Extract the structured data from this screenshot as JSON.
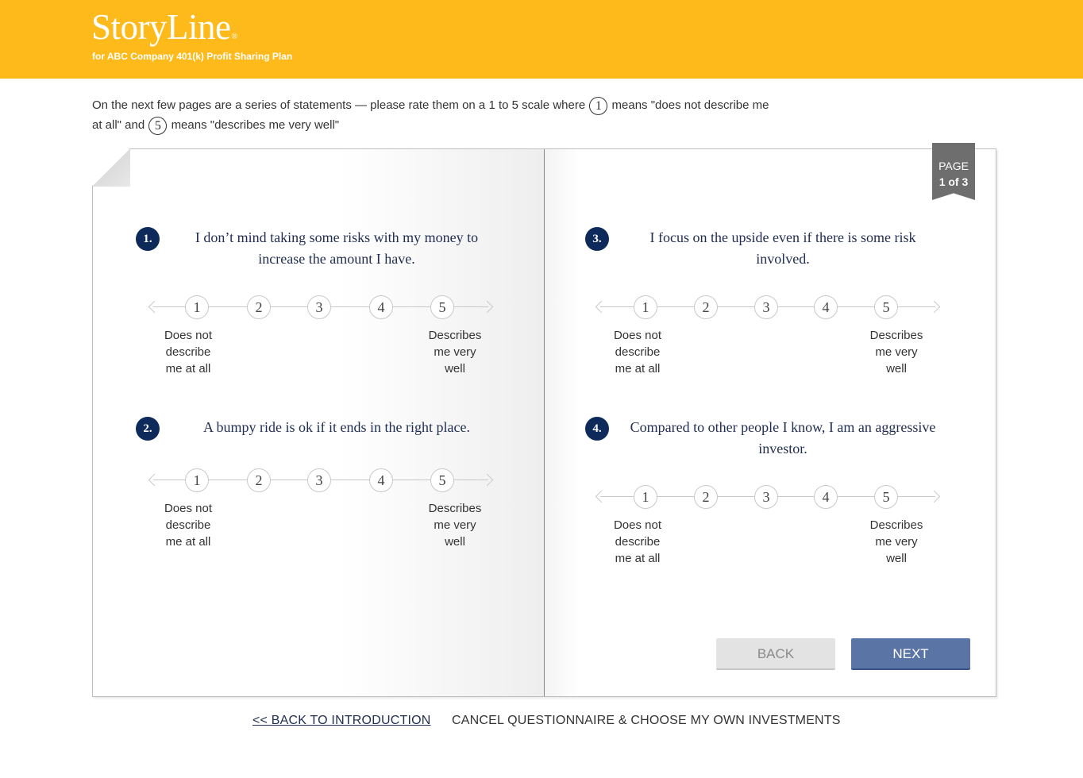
{
  "header": {
    "logo": "StoryLine",
    "logo_mark": "®",
    "subtitle": "for ABC Company 401(k) Profit Sharing Plan",
    "background_color": "#fdba1a"
  },
  "intro": {
    "part1": "On the next few pages are a series of statements — please rate them on a 1 to 5 scale where",
    "low_value": "1",
    "part2": "means \"does not describe me at all\" and",
    "high_value": "5",
    "part3": "means \"describes me very well\""
  },
  "page_indicator": {
    "label": "PAGE",
    "value": "1 of 3"
  },
  "questions": [
    {
      "number": "1.",
      "text_line1": "I don’t mind taking some risks with my money to",
      "text_line2": "increase the amount I have.",
      "options": [
        "1",
        "2",
        "3",
        "4",
        "5"
      ],
      "low_label": [
        "Does not",
        "describe",
        "me at all"
      ],
      "high_label": [
        "Describes",
        "me very",
        "well"
      ]
    },
    {
      "number": "2.",
      "text_line1": "A bumpy ride is ok if it ends in the right place.",
      "text_line2": "",
      "options": [
        "1",
        "2",
        "3",
        "4",
        "5"
      ],
      "low_label": [
        "Does not",
        "describe",
        "me at all"
      ],
      "high_label": [
        "Describes",
        "me very",
        "well"
      ]
    },
    {
      "number": "3.",
      "text_line1": "I focus on the upside even if there is some risk",
      "text_line2": "involved.",
      "options": [
        "1",
        "2",
        "3",
        "4",
        "5"
      ],
      "low_label": [
        "Does not",
        "describe",
        "me at all"
      ],
      "high_label": [
        "Describes",
        "me very",
        "well"
      ]
    },
    {
      "number": "4.",
      "text_line1": "Compared to other people I know, I am an aggressive",
      "text_line2": "investor.",
      "options": [
        "1",
        "2",
        "3",
        "4",
        "5"
      ],
      "low_label": [
        "Does not",
        "describe",
        "me at all"
      ],
      "high_label": [
        "Describes",
        "me very",
        "well"
      ]
    }
  ],
  "buttons": {
    "back": "BACK",
    "next": "NEXT"
  },
  "footer": {
    "back_link": "<< BACK TO INTRODUCTION",
    "cancel_link": "CANCEL QUESTIONNAIRE & CHOOSE MY OWN INVESTMENTS"
  }
}
